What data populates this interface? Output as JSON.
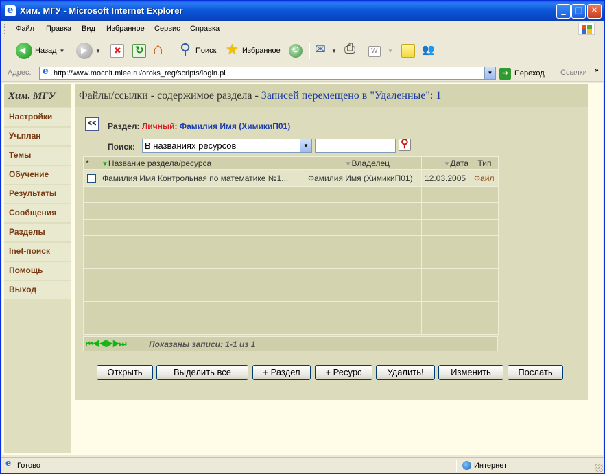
{
  "window": {
    "title": "Хим. МГУ - Microsoft Internet Explorer",
    "minimize": "_",
    "maximize": "□",
    "close": "✕"
  },
  "menu": [
    "Файл",
    "Правка",
    "Вид",
    "Избранное",
    "Сервис",
    "Справка"
  ],
  "toolbar": {
    "back": "Назад",
    "search": "Поиск",
    "favorites": "Избранное"
  },
  "address": {
    "label": "Адрес:",
    "url": "http://www.mocnit.miee.ru/oroks_reg/scripts/login.pl",
    "go": "Переход",
    "links": "Ссылки"
  },
  "sidebar": {
    "header": "Хим. МГУ",
    "items": [
      "Настройки",
      "Уч.план",
      "Темы",
      "Обучение",
      "Результаты",
      "Сообщения",
      "Разделы",
      "Inet-поиск",
      "Помощь",
      "Выход"
    ]
  },
  "main": {
    "header_prefix": "Файлы/ссылки - содержимое раздела - ",
    "header_status": "Записей перемещено в \"Удаленные\": 1",
    "back_button": "<<",
    "section_label": "Раздел:",
    "section_personal": "Личный:",
    "section_owner": "Фамилия Имя (ХимикиП01)",
    "search_label": "Поиск:",
    "search_select_value": "В названиях ресурсов",
    "search_input_value": ""
  },
  "table": {
    "columns": [
      "*",
      "Название раздела/ресурса",
      "Владелец",
      "Дата",
      "Тип"
    ],
    "rows": [
      {
        "name": "Фамилия Имя Контрольная по математике №1...",
        "owner": "Фамилия Имя (ХимикиП01)",
        "date": "12.03.2005",
        "type": "Файл"
      }
    ]
  },
  "pager": {
    "controls": "⏮◀◀▶▶⏭",
    "text": "Показаны записи: 1-1 из 1"
  },
  "buttons": [
    "Открыть",
    "Выделить все",
    "+ Раздел",
    "+ Ресурс",
    "Удалить!",
    "Изменить",
    "Послать"
  ],
  "status": {
    "left": "Готово",
    "zone": "Интернет"
  },
  "colors": {
    "title_bar": "#0b58d8",
    "sidebar_bg": "#dfdfc0",
    "nav_text": "#7b3a12",
    "personal": "#d32020",
    "owner": "#1f3fa8",
    "page_bg": "#fffde8"
  }
}
